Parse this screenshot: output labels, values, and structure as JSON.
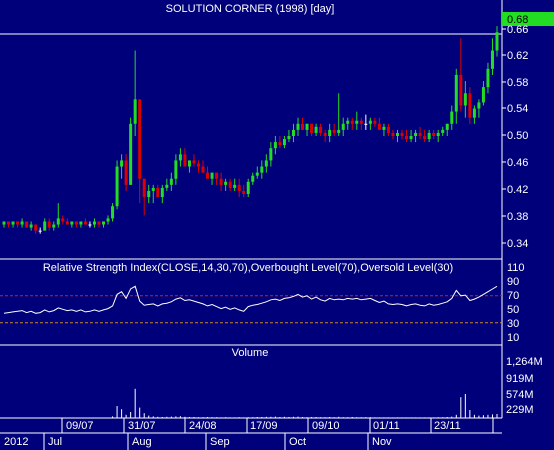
{
  "colors": {
    "background": "#00007a",
    "up_candle": "#22dd22",
    "down_candle": "#dd0000",
    "neutral_candle": "#ffffff",
    "last_price_marker": "#22dd22",
    "rsi_overbought_line": "#cc2222",
    "rsi_oversold_line": "#cc8822",
    "text": "#ffffff"
  },
  "chart_data": [
    {
      "type": "candlestick",
      "title": "SOLUTION CORNER (1998) [day]",
      "last_price": "0.68",
      "y_ticks": [
        "0.66",
        "0.62",
        "0.58",
        "0.54",
        "0.50",
        "0.46",
        "0.42",
        "0.38",
        "0.34"
      ],
      "ylim": [
        0.32,
        0.7
      ],
      "ohlc": [
        [
          0.365,
          0.37,
          0.36,
          0.37
        ],
        [
          0.37,
          0.37,
          0.36,
          0.365
        ],
        [
          0.365,
          0.37,
          0.36,
          0.37
        ],
        [
          0.37,
          0.37,
          0.36,
          0.365
        ],
        [
          0.365,
          0.375,
          0.36,
          0.37
        ],
        [
          0.37,
          0.37,
          0.36,
          0.36
        ],
        [
          0.36,
          0.37,
          0.355,
          0.365
        ],
        [
          0.365,
          0.365,
          0.35,
          0.355
        ],
        [
          0.355,
          0.36,
          0.35,
          0.355
        ],
        [
          0.355,
          0.375,
          0.355,
          0.37
        ],
        [
          0.37,
          0.375,
          0.355,
          0.36
        ],
        [
          0.36,
          0.37,
          0.355,
          0.365
        ],
        [
          0.365,
          0.4,
          0.36,
          0.375
        ],
        [
          0.375,
          0.38,
          0.365,
          0.37
        ],
        [
          0.37,
          0.375,
          0.365,
          0.365
        ],
        [
          0.365,
          0.37,
          0.36,
          0.37
        ],
        [
          0.37,
          0.37,
          0.36,
          0.365
        ],
        [
          0.365,
          0.37,
          0.36,
          0.37
        ],
        [
          0.37,
          0.375,
          0.365,
          0.365
        ],
        [
          0.365,
          0.37,
          0.36,
          0.365
        ],
        [
          0.365,
          0.375,
          0.36,
          0.37
        ],
        [
          0.37,
          0.37,
          0.36,
          0.365
        ],
        [
          0.365,
          0.37,
          0.36,
          0.37
        ],
        [
          0.37,
          0.38,
          0.365,
          0.375
        ],
        [
          0.375,
          0.4,
          0.37,
          0.395
        ],
        [
          0.395,
          0.47,
          0.39,
          0.46
        ],
        [
          0.46,
          0.48,
          0.44,
          0.47
        ],
        [
          0.47,
          0.48,
          0.42,
          0.43
        ],
        [
          0.43,
          0.54,
          0.43,
          0.53
        ],
        [
          0.53,
          0.65,
          0.51,
          0.57
        ],
        [
          0.57,
          0.57,
          0.4,
          0.44
        ],
        [
          0.44,
          0.44,
          0.38,
          0.41
        ],
        [
          0.41,
          0.43,
          0.4,
          0.42
        ],
        [
          0.42,
          0.43,
          0.4,
          0.425
        ],
        [
          0.425,
          0.43,
          0.41,
          0.41
        ],
        [
          0.41,
          0.43,
          0.4,
          0.425
        ],
        [
          0.425,
          0.44,
          0.42,
          0.43
        ],
        [
          0.43,
          0.45,
          0.42,
          0.44
        ],
        [
          0.44,
          0.48,
          0.43,
          0.47
        ],
        [
          0.47,
          0.49,
          0.46,
          0.48
        ],
        [
          0.48,
          0.49,
          0.46,
          0.46
        ],
        [
          0.46,
          0.47,
          0.45,
          0.47
        ],
        [
          0.47,
          0.48,
          0.46,
          0.465
        ],
        [
          0.465,
          0.47,
          0.45,
          0.46
        ],
        [
          0.46,
          0.47,
          0.45,
          0.45
        ],
        [
          0.45,
          0.46,
          0.44,
          0.44
        ],
        [
          0.44,
          0.45,
          0.43,
          0.45
        ],
        [
          0.45,
          0.45,
          0.43,
          0.44
        ],
        [
          0.44,
          0.45,
          0.42,
          0.43
        ],
        [
          0.43,
          0.44,
          0.42,
          0.435
        ],
        [
          0.435,
          0.44,
          0.42,
          0.425
        ],
        [
          0.425,
          0.44,
          0.42,
          0.43
        ],
        [
          0.43,
          0.44,
          0.41,
          0.42
        ],
        [
          0.42,
          0.43,
          0.41,
          0.415
        ],
        [
          0.415,
          0.44,
          0.41,
          0.435
        ],
        [
          0.435,
          0.45,
          0.43,
          0.445
        ],
        [
          0.445,
          0.46,
          0.44,
          0.45
        ],
        [
          0.45,
          0.47,
          0.44,
          0.46
        ],
        [
          0.46,
          0.48,
          0.45,
          0.47
        ],
        [
          0.47,
          0.5,
          0.46,
          0.49
        ],
        [
          0.49,
          0.51,
          0.48,
          0.5
        ],
        [
          0.5,
          0.51,
          0.49,
          0.495
        ],
        [
          0.495,
          0.51,
          0.49,
          0.505
        ],
        [
          0.505,
          0.52,
          0.5,
          0.51
        ],
        [
          0.51,
          0.53,
          0.5,
          0.52
        ],
        [
          0.52,
          0.54,
          0.51,
          0.53
        ],
        [
          0.53,
          0.54,
          0.52,
          0.52
        ],
        [
          0.52,
          0.53,
          0.51,
          0.53
        ],
        [
          0.53,
          0.53,
          0.51,
          0.515
        ],
        [
          0.515,
          0.53,
          0.51,
          0.525
        ],
        [
          0.525,
          0.53,
          0.51,
          0.515
        ],
        [
          0.515,
          0.52,
          0.5,
          0.51
        ],
        [
          0.51,
          0.53,
          0.5,
          0.52
        ],
        [
          0.52,
          0.53,
          0.51,
          0.515
        ],
        [
          0.515,
          0.58,
          0.51,
          0.52
        ],
        [
          0.52,
          0.54,
          0.51,
          0.53
        ],
        [
          0.53,
          0.54,
          0.52,
          0.535
        ],
        [
          0.535,
          0.54,
          0.52,
          0.53
        ],
        [
          0.53,
          0.55,
          0.52,
          0.535
        ],
        [
          0.535,
          0.54,
          0.52,
          0.53
        ],
        [
          0.53,
          0.545,
          0.52,
          0.53
        ],
        [
          0.53,
          0.54,
          0.52,
          0.535
        ],
        [
          0.535,
          0.54,
          0.525,
          0.53
        ],
        [
          0.53,
          0.54,
          0.52,
          0.52
        ],
        [
          0.52,
          0.53,
          0.51,
          0.525
        ],
        [
          0.525,
          0.53,
          0.51,
          0.515
        ],
        [
          0.515,
          0.52,
          0.505,
          0.51
        ],
        [
          0.51,
          0.52,
          0.5,
          0.515
        ],
        [
          0.515,
          0.52,
          0.505,
          0.51
        ],
        [
          0.51,
          0.52,
          0.5,
          0.505
        ],
        [
          0.505,
          0.52,
          0.5,
          0.51
        ],
        [
          0.51,
          0.52,
          0.5,
          0.515
        ],
        [
          0.515,
          0.525,
          0.505,
          0.51
        ],
        [
          0.51,
          0.52,
          0.5,
          0.505
        ],
        [
          0.505,
          0.52,
          0.5,
          0.515
        ],
        [
          0.515,
          0.52,
          0.505,
          0.51
        ],
        [
          0.51,
          0.52,
          0.5,
          0.515
        ],
        [
          0.515,
          0.525,
          0.51,
          0.52
        ],
        [
          0.52,
          0.53,
          0.51,
          0.53
        ],
        [
          0.53,
          0.56,
          0.52,
          0.55
        ],
        [
          0.55,
          0.62,
          0.53,
          0.61
        ],
        [
          0.61,
          0.67,
          0.55,
          0.56
        ],
        [
          0.56,
          0.6,
          0.54,
          0.58
        ],
        [
          0.58,
          0.59,
          0.53,
          0.54
        ],
        [
          0.54,
          0.56,
          0.53,
          0.555
        ],
        [
          0.555,
          0.57,
          0.54,
          0.565
        ],
        [
          0.565,
          0.6,
          0.56,
          0.59
        ],
        [
          0.59,
          0.63,
          0.58,
          0.62
        ],
        [
          0.62,
          0.67,
          0.61,
          0.65
        ],
        [
          0.65,
          0.69,
          0.64,
          0.68
        ]
      ]
    },
    {
      "type": "line",
      "title": "Relative Strength Index(CLOSE,14,30,70),Overbought Level(70),Oversold Level(30)",
      "y_ticks": [
        "110",
        "90",
        "70",
        "50",
        "30",
        "10"
      ],
      "ylim": [
        0,
        120
      ],
      "overbought": 70,
      "oversold": 30,
      "values": [
        44,
        45,
        46,
        47,
        48,
        45,
        47,
        44,
        45,
        49,
        46,
        48,
        52,
        50,
        48,
        49,
        47,
        49,
        46,
        47,
        49,
        47,
        49,
        51,
        55,
        72,
        76,
        66,
        80,
        84,
        62,
        56,
        57,
        58,
        55,
        58,
        59,
        61,
        65,
        67,
        63,
        64,
        62,
        60,
        58,
        55,
        57,
        54,
        51,
        53,
        50,
        52,
        49,
        47,
        54,
        56,
        57,
        59,
        61,
        64,
        65,
        63,
        66,
        67,
        69,
        72,
        68,
        70,
        65,
        68,
        64,
        62,
        66,
        64,
        65,
        64,
        66,
        65,
        66,
        64,
        65,
        66,
        63,
        60,
        62,
        58,
        57,
        58,
        57,
        55,
        57,
        58,
        56,
        55,
        58,
        56,
        57,
        59,
        61,
        66,
        78,
        70,
        71,
        63,
        65,
        68,
        72,
        76,
        80,
        84
      ]
    },
    {
      "type": "bar",
      "title": "Volume",
      "y_ticks": [
        "1,264M",
        "919M",
        "574M",
        "229M"
      ],
      "ylim": [
        0,
        1450
      ],
      "values": [
        2,
        2,
        3,
        2,
        2,
        3,
        2,
        2,
        3,
        2,
        2,
        3,
        5,
        3,
        2,
        2,
        3,
        2,
        2,
        3,
        2,
        3,
        2,
        4,
        40,
        300,
        220,
        80,
        150,
        730,
        260,
        120,
        60,
        40,
        30,
        25,
        30,
        35,
        40,
        45,
        30,
        25,
        25,
        20,
        20,
        25,
        20,
        20,
        15,
        20,
        15,
        15,
        20,
        15,
        20,
        20,
        25,
        25,
        30,
        30,
        35,
        25,
        30,
        25,
        30,
        35,
        25,
        20,
        25,
        25,
        20,
        20,
        25,
        20,
        30,
        20,
        20,
        25,
        20,
        20,
        20,
        20,
        15,
        15,
        15,
        15,
        15,
        15,
        15,
        15,
        15,
        15,
        15,
        15,
        15,
        15,
        20,
        20,
        25,
        35,
        80,
        520,
        600,
        200,
        80,
        60,
        70,
        80,
        90,
        100
      ]
    }
  ],
  "x_axis": {
    "date_ticks": [
      "09/07",
      "31/07",
      "24/08",
      "17/09",
      "09/10",
      "01/11",
      "23/11"
    ],
    "month_labels": [
      "2012",
      "Jul",
      "Aug",
      "Sep",
      "Oct",
      "Nov"
    ]
  }
}
